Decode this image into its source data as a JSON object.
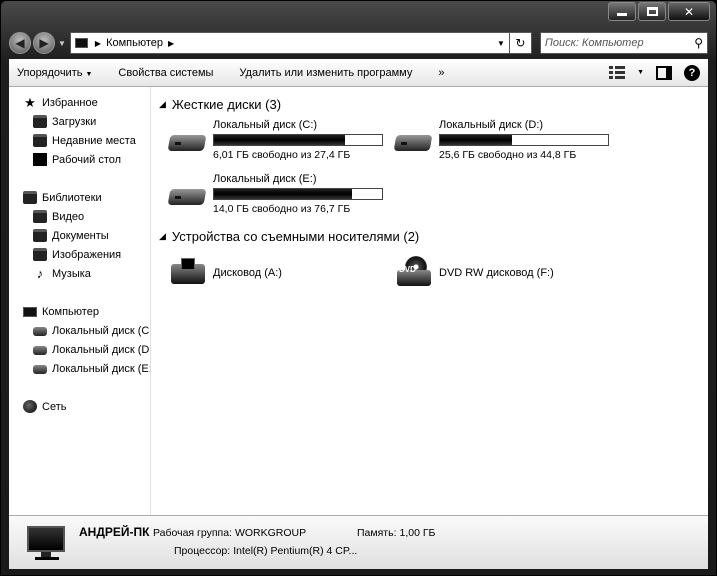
{
  "nav": {
    "breadcrumb": "Компьютер",
    "search_placeholder": "Поиск: Компьютер"
  },
  "toolbar": {
    "organize": "Упорядочить",
    "system_properties": "Свойства системы",
    "uninstall": "Удалить или изменить программу",
    "more": "»"
  },
  "sidebar": {
    "favorites": "Избранное",
    "downloads": "Загрузки",
    "recent": "Недавние места",
    "desktop": "Рабочий стол",
    "libraries": "Библиотеки",
    "video": "Видео",
    "documents": "Документы",
    "pictures": "Изображения",
    "music": "Музыка",
    "computer": "Компьютер",
    "drive_c": "Локальный диск (C:",
    "drive_d": "Локальный диск (D:",
    "drive_e": "Локальный диск (E:)",
    "network": "Сеть"
  },
  "hard_drives": {
    "heading": "Жесткие диски (3)",
    "items": [
      {
        "name": "Локальный диск (C:)",
        "free": "6,01 ГБ свободно из 27,4 ГБ",
        "used_fraction": 0.78
      },
      {
        "name": "Локальный диск (D:)",
        "free": "25,6 ГБ свободно из 44,8 ГБ",
        "used_fraction": 0.43
      },
      {
        "name": "Локальный диск (E:)",
        "free": "14,0 ГБ свободно из 76,7 ГБ",
        "used_fraction": 0.82
      }
    ]
  },
  "removable": {
    "heading": "Устройства со съемными носителями (2)",
    "items": [
      {
        "name": "Дисковод (A:)"
      },
      {
        "name": "DVD RW дисковод (F:)"
      }
    ]
  },
  "details": {
    "computer_name": "АНДРЕЙ-ПК",
    "workgroup_label": "Рабочая группа:",
    "workgroup": "WORKGROUP",
    "memory_label": "Память:",
    "memory": "1,00 ГБ",
    "cpu_label": "Процессор:",
    "cpu": "Intel(R) Pentium(R) 4 CP..."
  }
}
